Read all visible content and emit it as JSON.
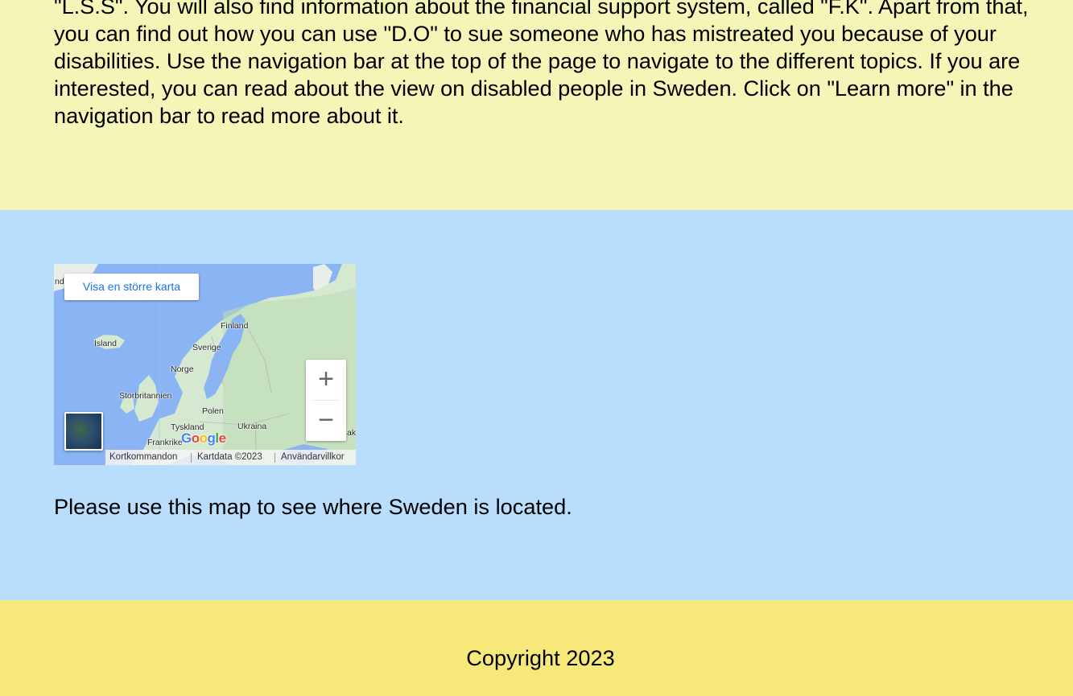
{
  "intro": {
    "text": "\"L.S.S\". You will also find information about the financial support system, called \"F.K\". Apart from that, you can find out how you can use \"D.O\" to sue someone who has mistreated you because of your disabilities. Use the navigation bar at the top of the page to navigate to the different topics. If you are interested, you can read about the view on disabled people in Sweden. Click on \"Learn more\" in the navigation bar to read more about it."
  },
  "map": {
    "larger_map_label": "Visa en större karta",
    "zoom_in_label": "+",
    "zoom_out_label": "−",
    "logo_letters": [
      "G",
      "o",
      "o",
      "g",
      "l",
      "e"
    ],
    "logo_colors": [
      "#4285f4",
      "#ea4335",
      "#fbbc05",
      "#4285f4",
      "#34a853",
      "#ea4335"
    ],
    "attribution": {
      "shortcuts": "Kortkommandon",
      "map_data": "Kartdata ©2023",
      "terms": "Användarvillkor"
    },
    "labels": {
      "nd": "nd",
      "finland": "Finland",
      "island": "Island",
      "sverige": "Sverige",
      "norge": "Norge",
      "storbritannien": "Storbritannien",
      "polen": "Polen",
      "tyskland": "Tyskland",
      "ukraina": "Ukraina",
      "frankrike": "Frankrike",
      "ak": "ak"
    },
    "colors": {
      "water": "#8ab4f3",
      "land": "#d4e9cf",
      "forest": "#bcdcb4"
    }
  },
  "caption": "Please use this map to see where Sweden is located.",
  "footer": {
    "copyright": "Copyright 2023"
  },
  "colors": {
    "intro_bg": "#f6f5b8",
    "map_section_bg": "#b9ddfc",
    "footer_bg": "#f6e97a"
  }
}
